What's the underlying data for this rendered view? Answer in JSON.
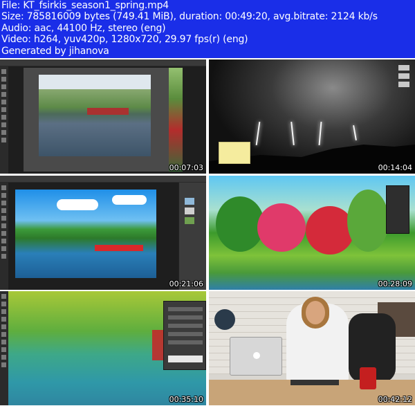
{
  "info": {
    "file": "File: KT_fsirkis_season1_spring.mp4",
    "size": "Size: 785816009 bytes (749.41 MiB), duration: 00:49:20, avg.bitrate: 2124 kb/s",
    "audio": "Audio: aac, 44100 Hz, stereo (eng)",
    "video": "Video: h264, yuv420p, 1280x720, 29.97 fps(r) (eng)",
    "generated": "Generated by jihanova"
  },
  "thumbnails": [
    {
      "timestamp": "00:07:03"
    },
    {
      "timestamp": "00:14:04"
    },
    {
      "timestamp": "00:21:06"
    },
    {
      "timestamp": "00:28:09"
    },
    {
      "timestamp": "00:35:10"
    },
    {
      "timestamp": "00:42:12"
    }
  ],
  "colors": {
    "header_background": "#1a2ee8",
    "header_text": "#ffffff"
  }
}
